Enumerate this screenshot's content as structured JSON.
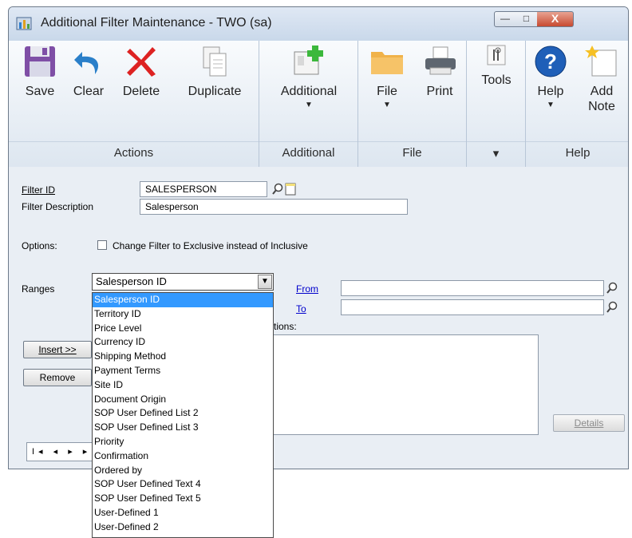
{
  "window": {
    "title": "Additional Filter Maintenance  -  TWO (sa)",
    "controls": {
      "minimize": "—",
      "maximize": "□",
      "close": "X"
    }
  },
  "ribbon": {
    "groups": {
      "actions": "Actions",
      "additional": "Additional",
      "file": "File",
      "tools_arrow": "▾",
      "help": "Help"
    },
    "buttons": {
      "save": "Save",
      "clear": "Clear",
      "delete": "Delete",
      "duplicate": "Duplicate",
      "additional": "Additional",
      "file": "File",
      "print": "Print",
      "tools": "Tools",
      "help": "Help",
      "add_note_line1": "Add",
      "add_note_line2": "Note"
    },
    "dropdown_arrow": "▼"
  },
  "form": {
    "filter_id_label": "Filter ID",
    "filter_id_value": "SALESPERSON",
    "filter_description_label": "Filter Description",
    "filter_description_value": "Salesperson",
    "options_label": "Options:",
    "exclusive_checkbox_label": "Change Filter to Exclusive instead of Inclusive",
    "exclusive_checked": false,
    "ranges_label": "Ranges",
    "ranges_selected": "Salesperson ID",
    "from_label": "From",
    "from_value": "",
    "to_label": "To",
    "to_value": "",
    "restrictions_label": "tions:",
    "insert_button": "Insert >>",
    "remove_button": "Remove",
    "details_button": "Details",
    "nav_symbols": "I◂ ◂ ▸ ▸I"
  },
  "ranges_options": [
    "Salesperson ID",
    "Territory ID",
    "Price Level",
    "Currency ID",
    "Shipping Method",
    "Payment Terms",
    "Site ID",
    "Document Origin",
    "SOP User Defined List 2",
    "SOP User Defined List 3",
    "Priority",
    "Confirmation",
    "Ordered by",
    "SOP User Defined Text 4",
    "SOP User Defined Text 5",
    "User-Defined 1",
    "User-Defined 2"
  ],
  "colors": {
    "selected_item": "#3399ff",
    "link": "#0000cc",
    "window_bg": "#e9eef4"
  }
}
